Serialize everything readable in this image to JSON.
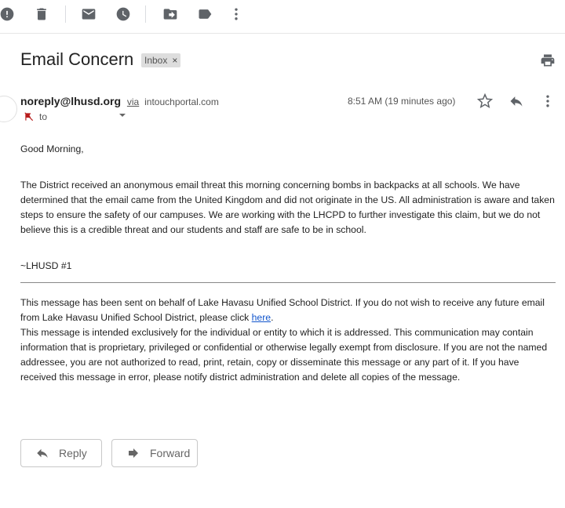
{
  "toolbar": {
    "icons": [
      "report-spam-icon",
      "delete-icon",
      "mark-unread-icon",
      "snooze-icon",
      "move-to-icon",
      "label-icon",
      "more-vert-icon"
    ]
  },
  "header": {
    "subject": "Email Concern",
    "label_chip": "Inbox",
    "label_remove": "×"
  },
  "message": {
    "sender_name": "noreply@lhusd.org",
    "via": "via",
    "via_domain": "intouchportal.com",
    "to_label": "to",
    "timestamp": "8:51 AM (19 minutes ago)",
    "greeting": "Good Morning,",
    "paragraph": "The District received an anonymous email threat this morning concerning bombs in backpacks at all schools. We have determined that the email came from the United Kingdom and did not originate in the US. All administration is aware and taken steps to ensure the safety of our campuses. We are working with the LHCPD to further investigate this claim, but we do not believe this is a credible threat and our students and staff are safe to be in school.",
    "signature": "~LHUSD #1",
    "disclaimer_1": "This message has been sent on behalf of Lake Havasu Unified School District. If you do not wish to receive any future email from Lake Havasu Unified School District, please click ",
    "disclaimer_link": "here",
    "disclaimer_1_end": ".",
    "disclaimer_2": "This message is intended exclusively for the individual or entity to which it is addressed. This communication may contain information that is proprietary, privileged or confidential or otherwise legally exempt from disclosure. If you are not the named addressee, you are not authorized to read, print, retain, copy or disseminate this message or any part of it. If you have received this message in error, please notify district administration and delete all copies of the message."
  },
  "actions": {
    "reply": "Reply",
    "forward": "Forward"
  },
  "colors": {
    "link": "#1155cc",
    "icon": "#5f6368"
  }
}
